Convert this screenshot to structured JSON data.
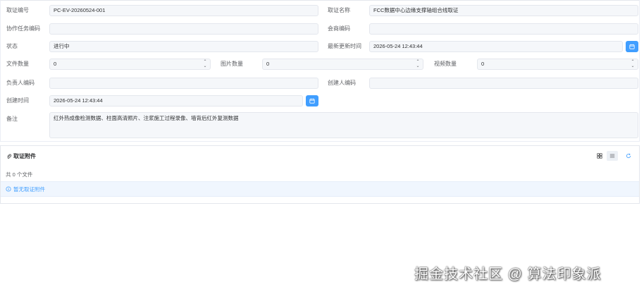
{
  "form": {
    "evidence_no": {
      "label": "取证编号",
      "value": "PC-EV-20260524-001"
    },
    "evidence_name": {
      "label": "取证名称",
      "value": "FCC数据中心边缘支撑轴组合线取证"
    },
    "collab_task_code": {
      "label": "协作任务编码",
      "value": ""
    },
    "meeting_code": {
      "label": "会商编码",
      "value": ""
    },
    "status": {
      "label": "状态",
      "value": "进行中"
    },
    "last_update_time": {
      "label": "最新更新时间",
      "value": "2026-05-24 12:43:44"
    },
    "file_count": {
      "label": "文件数量",
      "value": "0"
    },
    "image_count": {
      "label": "图片数量",
      "value": "0"
    },
    "video_count": {
      "label": "视频数量",
      "value": "0"
    },
    "owner_code": {
      "label": "负责人编码",
      "value": ""
    },
    "creator_code": {
      "label": "创建人编码",
      "value": ""
    },
    "created_time": {
      "label": "创建时间",
      "value": "2026-05-24 12:43:44"
    },
    "remark": {
      "label": "备注",
      "value": "红外热成像检测数据、柱面高清照片、注浆施工过程录像、墙背后红外复测数据"
    }
  },
  "attachments": {
    "title": "取证附件",
    "count_text": "共 0 个文件",
    "empty_text": "暂无取证附件"
  },
  "watermark": "掘金技术社区 @ 算法印象派",
  "colors": {
    "primary": "#409eff",
    "field_bg": "#f5f7fa",
    "border": "#e4e7ed"
  },
  "icons": {
    "date": "calendar-icon",
    "spin": "chevron-up-down-icon",
    "attach": "paperclip-icon",
    "grid": "grid-icon",
    "list": "list-icon",
    "refresh": "refresh-icon",
    "info": "info-circle-icon"
  }
}
